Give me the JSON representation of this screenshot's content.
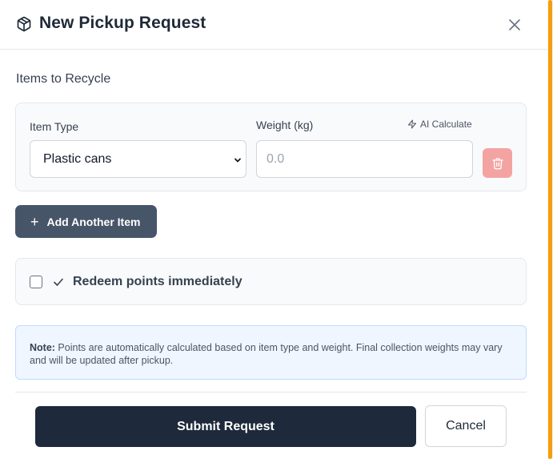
{
  "dialog": {
    "title": "New Pickup Request",
    "icon": "package-icon"
  },
  "items_section": {
    "title": "Items to Recycle",
    "item_type_label": "Item Type",
    "item_type_value": "Plastic cans",
    "weight_label": "Weight (kg)",
    "weight_placeholder": "0.0",
    "weight_value": "",
    "ai_calculate_label": "AI Calculate",
    "add_item_label": "Add Another Item"
  },
  "redeem": {
    "label": "Redeem points immediately",
    "checked": false
  },
  "note": {
    "prefix": "Note:",
    "text": " Points are automatically calculated based on item type and weight. Final collection weights may vary and will be updated after pickup."
  },
  "footer": {
    "submit_label": "Submit Request",
    "cancel_label": "Cancel"
  },
  "colors": {
    "primary": "#1e293b",
    "secondary_button": "#475569",
    "delete_button": "#f4a3a3",
    "note_background": "#eff6ff",
    "scrollbar": "#f59e0b"
  }
}
